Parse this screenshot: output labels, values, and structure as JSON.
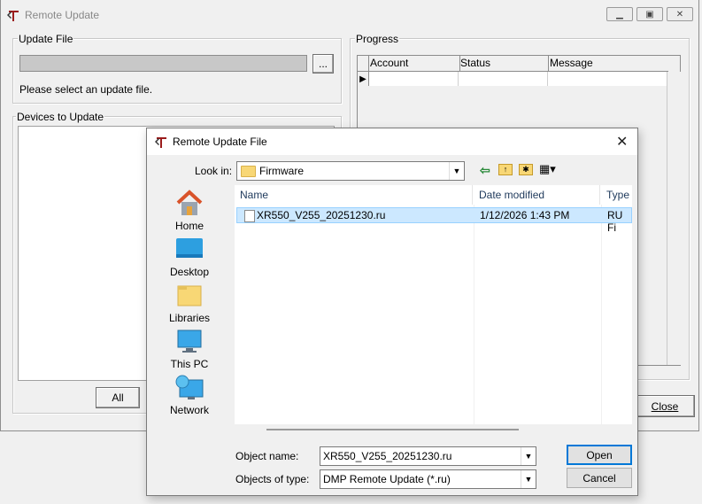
{
  "main_window": {
    "title": "Remote Update",
    "update_file": {
      "group_label": "Update File",
      "path_value": "",
      "browse_label": "...",
      "hint": "Please select an update file."
    },
    "devices": {
      "group_label": "Devices to Update",
      "all_button": "All"
    },
    "progress": {
      "group_label": "Progress",
      "columns": [
        "Account",
        "Status",
        "Message"
      ]
    },
    "close_button": "Close"
  },
  "dialog": {
    "title": "Remote Update File",
    "look_in_label": "Look in:",
    "look_in_value": "Firmware",
    "nav": [
      {
        "label": "Home",
        "icon": "home-icon"
      },
      {
        "label": "Desktop",
        "icon": "desktop-icon"
      },
      {
        "label": "Libraries",
        "icon": "libraries-icon"
      },
      {
        "label": "This PC",
        "icon": "this-pc-icon"
      },
      {
        "label": "Network",
        "icon": "network-icon"
      }
    ],
    "columns": [
      "Name",
      "Date modified",
      "Type"
    ],
    "files": [
      {
        "name": "XR550_V255_20251230.ru",
        "date": "1/12/2026 1:43 PM",
        "type": "RU Fi"
      }
    ],
    "object_name_label": "Object name:",
    "object_name_value": "XR550_V255_20251230.ru",
    "object_type_label": "Objects of type:",
    "object_type_value": "DMP Remote Update (*.ru)",
    "open_button": "Open",
    "cancel_button": "Cancel"
  },
  "colors": {
    "selection": "#cce8ff",
    "selection_border": "#99d1ff",
    "folder": "#f8d775",
    "header_text": "#1e395b"
  }
}
